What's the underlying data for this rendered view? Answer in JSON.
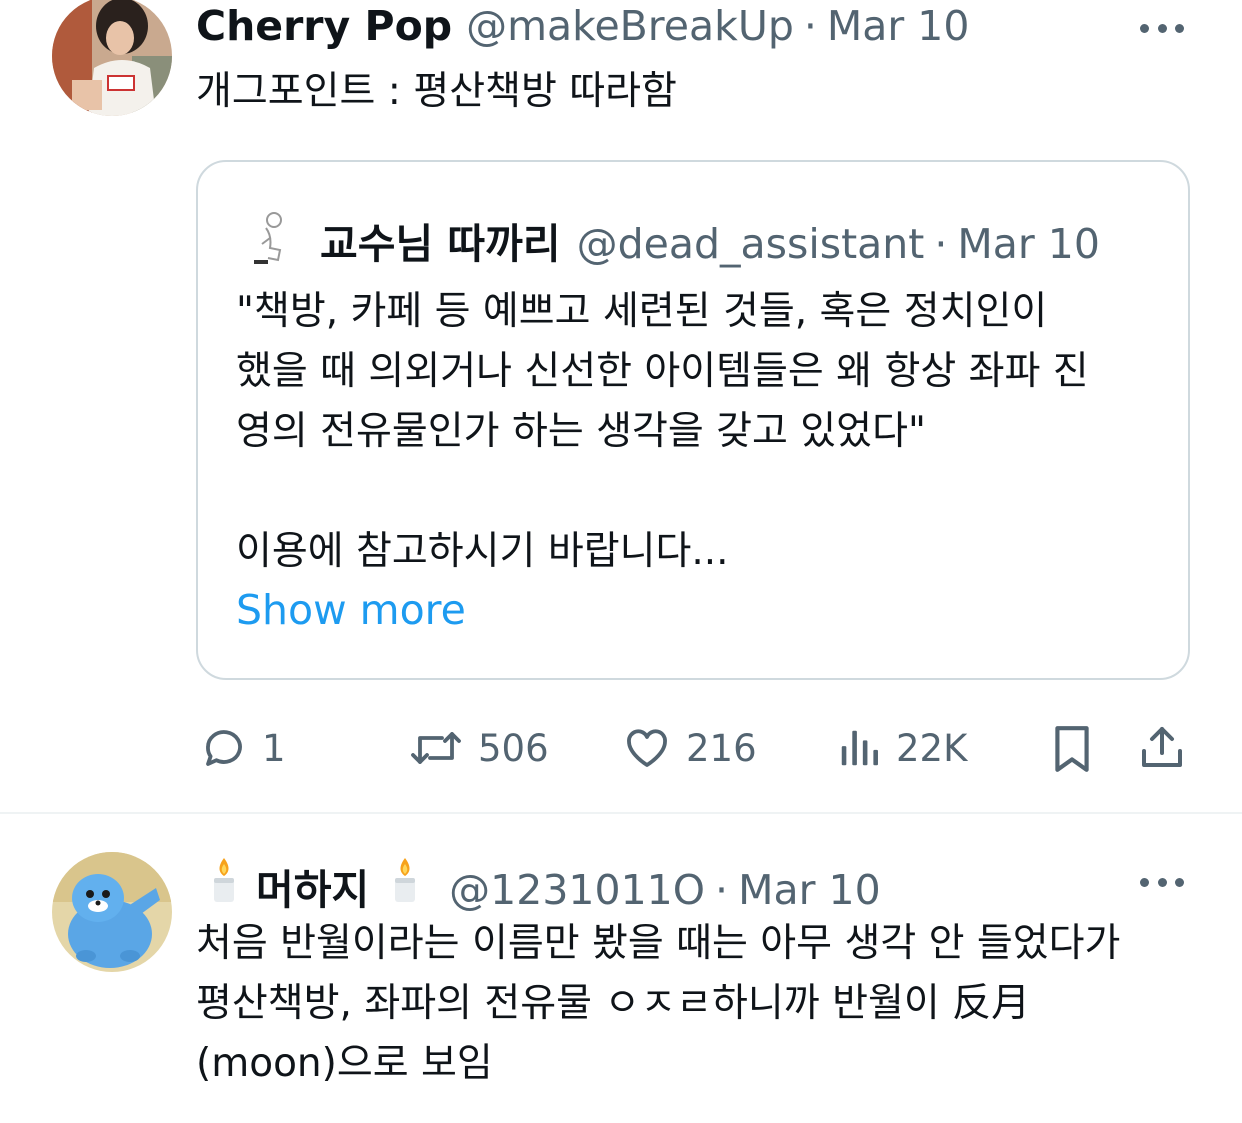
{
  "tweet1": {
    "display_name": "Cherry Pop",
    "handle": "@makeBreakUp",
    "separator": "·",
    "date": "Mar 10",
    "text": "개그포인트 : 평산책방 따라함",
    "avatar_icon": "profile-photo-avatar",
    "more_icon": "more-icon"
  },
  "quote": {
    "display_name": "교수님 따까리",
    "handle": "@dead_assistant",
    "separator": "·",
    "date": "Mar 10",
    "lines": [
      "\"책방, 카페 등 예쁘고 세련된 것들, 혹은 정치인이",
      "했을 때 의외거나 신선한 아이템들은 왜 항상 좌파 진",
      "영의 전유물인가 하는 생각을 갖고 있었다\""
    ],
    "line_last": "이용에 참고하시기 바랍니다...",
    "show_more": "Show more",
    "link_color": "#1d9bf0"
  },
  "actions": {
    "replies": "1",
    "retweets": "506",
    "likes": "216",
    "views": "22K"
  },
  "tweet2": {
    "display_name": "머하지",
    "name_emoji": "candle-emoji",
    "handle": "@1231011O",
    "separator": "·",
    "date": "Mar 10",
    "lines": [
      "처음 반월이라는 이름만 봤을 때는 아무 생각 안 들었다가",
      "평산책방, 좌파의 전유물 ㅇㅈㄹ하니까 반월이 反月",
      "(moon)으로 보임"
    ],
    "avatar_icon": "blue-cartoon-avatar"
  },
  "colors": {
    "text": "#0f1419",
    "secondary": "#536471",
    "border": "#cfd9de",
    "accent": "#1d9bf0"
  }
}
